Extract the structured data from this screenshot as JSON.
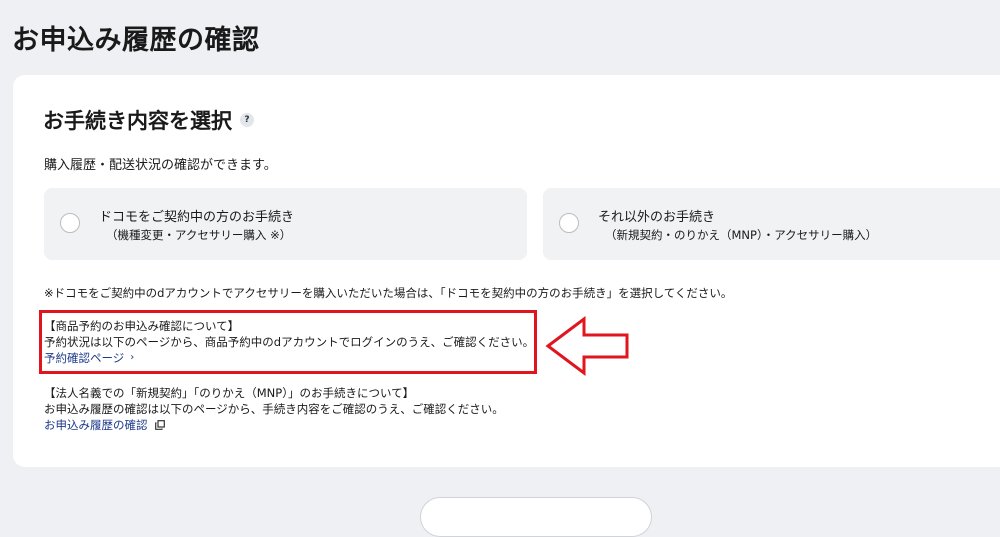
{
  "page": {
    "title": "お申込み履歴の確認"
  },
  "section": {
    "title": "お手続き内容を選択",
    "help_icon": "?",
    "description": "購入履歴・配送状況の確認ができます。"
  },
  "options": [
    {
      "label": "ドコモをご契約中の方のお手続き",
      "sub": "（機種変更・アクセサリー購入 ※）"
    },
    {
      "label": "それ以外のお手続き",
      "sub": "（新規契約・のりかえ（MNP）・アクセサリー購入）"
    }
  ],
  "note": "※ドコモをご契約中のdアカウントでアクセサリーを購入いただいた場合は、「ドコモを契約中の方のお手続き」を選択してください。",
  "reservation": {
    "heading": "【商品予約のお申込み確認について】",
    "text": "予約状況は以下のページから、商品予約中のdアカウントでログインのうえ、ご確認ください。",
    "link": "予約確認ページ",
    "link_chevron": "›"
  },
  "corporate": {
    "heading": "【法人名義での「新規契約」「のりかえ（MNP）」のお手続きについて】",
    "text": "お申込み履歴の確認は以下のページから、手続き内容をご確認のうえ、ご確認ください。",
    "link": "お申込み履歴の確認"
  },
  "colors": {
    "highlight": "#e0151d",
    "link": "#1d3a8a",
    "option_bg": "#f1f2f4"
  }
}
